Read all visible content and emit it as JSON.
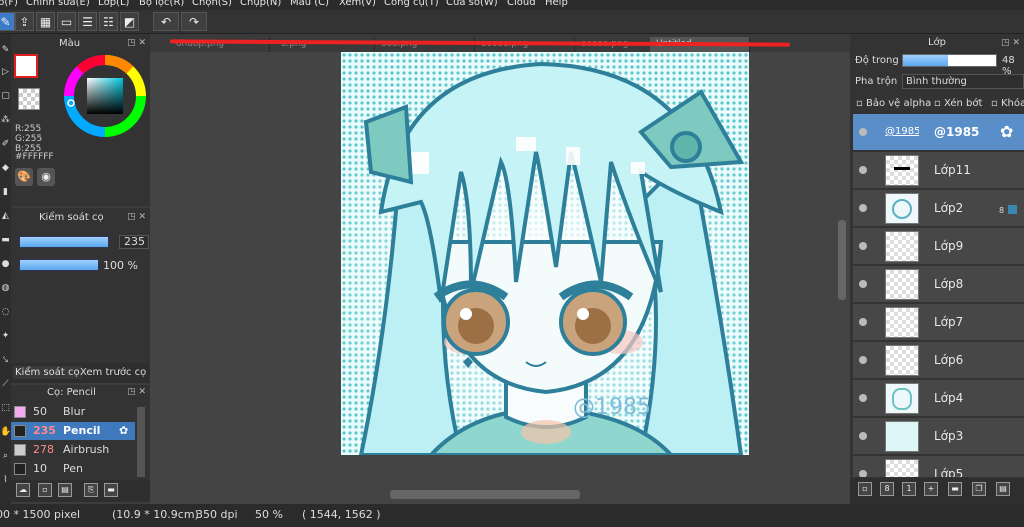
{
  "menu": [
    "p(F)",
    "Chỉnh sửa(E)",
    "Lớp(L)",
    "Bộ lọc(R)",
    "Chọn(S)",
    "Chụp(N)",
    "Màu (C)",
    "Xem(V)",
    "Công cụ(T)",
    "Cửa sổ(W)",
    "Cloud",
    "Help"
  ],
  "color_panel": {
    "title": "Màu",
    "r": "R:255",
    "g": "G:255",
    "b": "B:255",
    "hex": "#FFFFFF",
    "accent": "#e02020"
  },
  "brush_control": {
    "title": "Kiểm soát cọ",
    "size": "235",
    "opacity": "100 %",
    "size_fraction": 0.78,
    "opacity_fraction": 1.0,
    "tab1": "Kiểm soát cọ",
    "tab2": "Xem trước cọ"
  },
  "brush_list": {
    "title": "Cọ: Pencil",
    "items": [
      {
        "size": "50",
        "name": "Blur",
        "swatch": "#f4a8f0"
      },
      {
        "size": "235",
        "name": "Pencil",
        "swatch": "#222222",
        "selected": true
      },
      {
        "size": "278",
        "name": "Airbrush",
        "swatch": "#cccccc"
      },
      {
        "size": "10",
        "name": "Pen",
        "swatch": "#222222"
      }
    ]
  },
  "tabs": [
    "ohuop.png",
    "o.png",
    "ooo.png",
    "ooooo.png",
    "ooooo.png",
    "Untitled"
  ],
  "artwork": {
    "watermark": "@1985"
  },
  "layer_panel": {
    "title": "Lớp",
    "opacity_label": "Độ trong",
    "opacity_value": "48 %",
    "opacity_fraction": 0.48,
    "blend_label": "Pha trộn",
    "blend_value": "Bình thường",
    "protect_alpha": "Bảo vệ alpha",
    "clipping": "Xén bớt",
    "lock": "Khóa",
    "layers": [
      {
        "name": "@1985",
        "thumb_text": "@1985",
        "selected": true
      },
      {
        "name": "Lớp11"
      },
      {
        "name": "Lớp2",
        "badge": "8"
      },
      {
        "name": "Lớp9"
      },
      {
        "name": "Lớp8"
      },
      {
        "name": "Lớp7"
      },
      {
        "name": "Lớp6"
      },
      {
        "name": "Lớp4"
      },
      {
        "name": "Lớp3"
      },
      {
        "name": "Lớp5"
      }
    ]
  },
  "status": {
    "size": "00 * 1500 pixel",
    "cm": "(10.9 * 10.9cm)",
    "dpi": "350 dpi",
    "zoom": "50 %",
    "coords": "( 1544, 1562 )"
  }
}
